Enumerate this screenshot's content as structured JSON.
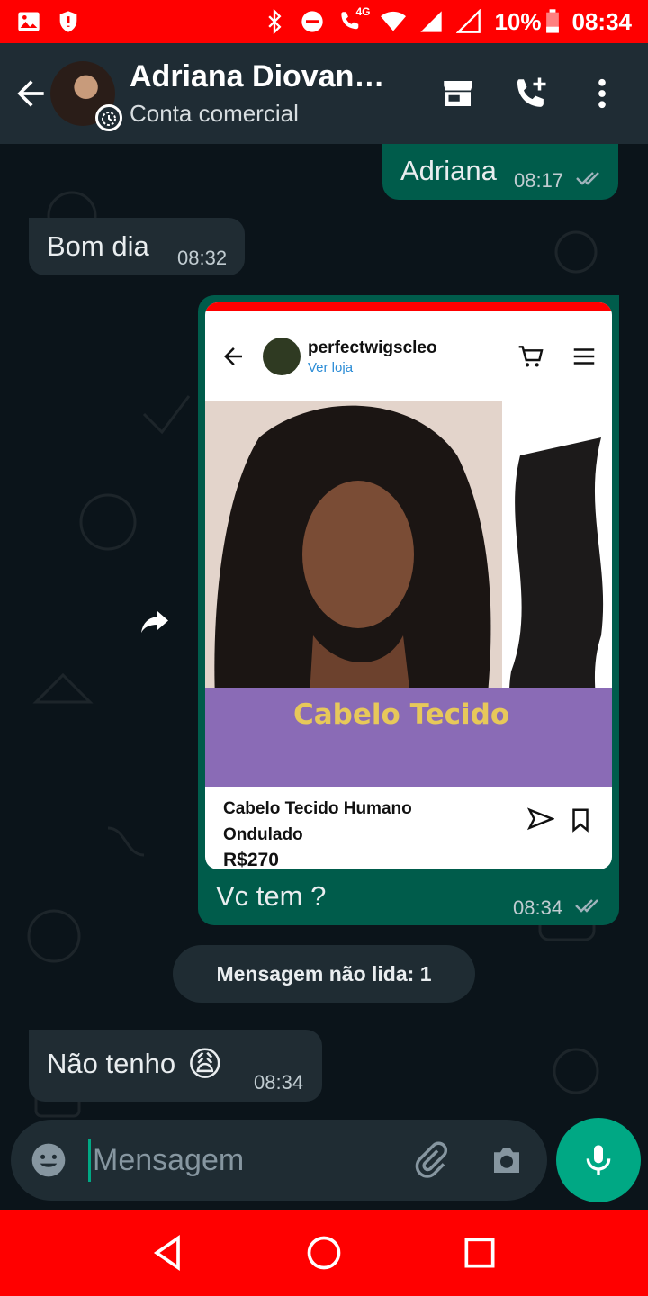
{
  "statusbar": {
    "battery": "10%",
    "time": "08:34",
    "icons": [
      "gallery-icon",
      "shield-icon",
      "bluetooth-icon",
      "dnd-icon",
      "volte-call-icon",
      "wifi-icon",
      "signal-icon",
      "signal-empty-icon",
      "battery-low-icon"
    ],
    "network_label": "4G"
  },
  "header": {
    "contact_name": "Adriana Diovana…",
    "subtitle": "Conta comercial",
    "actions": [
      "store-icon",
      "add-call-icon",
      "more-vert-icon"
    ]
  },
  "messages": [
    {
      "direction": "out",
      "text": "Adriana",
      "time": "08:17",
      "status": "read"
    },
    {
      "direction": "in",
      "text": "Bom dia",
      "time": "08:32"
    },
    {
      "direction": "out",
      "type": "product_share",
      "card": {
        "shop_name": "perfectwigscleo",
        "shop_link": "Ver loja",
        "banner_text": "Cabelo Tecido",
        "product_name": "Cabelo Tecido Humano Ondulado",
        "price": "R$270"
      },
      "caption": "Vc tem ?",
      "time": "08:34",
      "status": "read"
    },
    {
      "type": "system",
      "text": "Mensagem não lida: 1"
    },
    {
      "direction": "in",
      "text": "Não tenho",
      "emoji": "😩",
      "time": "08:34"
    }
  ],
  "composer": {
    "placeholder": "Mensagem"
  },
  "colors": {
    "statusbar": "#ff0000",
    "appbar": "#1f2c34",
    "chat_bg": "#0b141a",
    "outgoing": "#005c4b",
    "incoming": "#202c33",
    "accent": "#00a884"
  }
}
